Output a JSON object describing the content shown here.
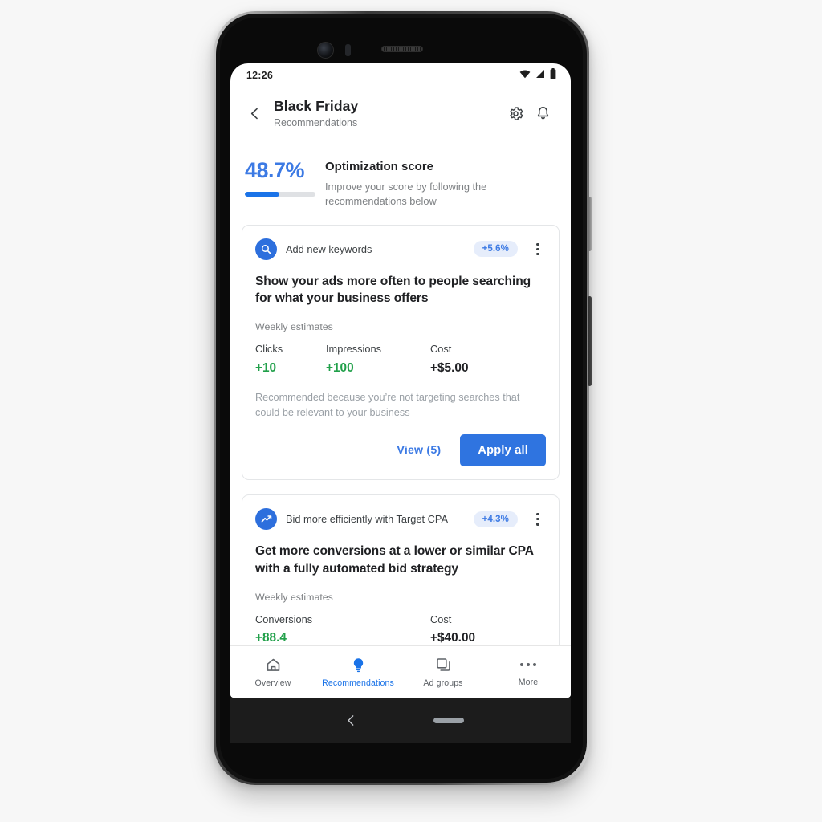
{
  "status_bar": {
    "time": "12:26",
    "icons": [
      "wifi-icon",
      "cellular-signal-icon",
      "battery-icon"
    ]
  },
  "app_bar": {
    "back_icon": "chevron-left-icon",
    "title": "Black Friday",
    "subtitle": "Recommendations",
    "actions": [
      {
        "icon": "gear-icon",
        "name": "settings"
      },
      {
        "icon": "bell-icon",
        "name": "notifications"
      }
    ]
  },
  "optimization_score": {
    "value": "48.7%",
    "progress_percent": 48.7,
    "heading": "Optimization score",
    "description": "Improve your score by following the recommendations below"
  },
  "cards": [
    {
      "icon": "search-icon",
      "type_label": "Add new keywords",
      "badge": "+5.6%",
      "menu_icon": "more-vertical-icon",
      "headline": "Show your ads more often to people searching for what your business offers",
      "estimates_label": "Weekly estimates",
      "stats": [
        {
          "label": "Clicks",
          "value": "+10",
          "tone": "positive"
        },
        {
          "label": "Impressions",
          "value": "+100",
          "tone": "positive"
        },
        {
          "label": "Cost",
          "value": "+$5.00",
          "tone": "neutral"
        }
      ],
      "reason": "Recommended because you’re not targeting searches that could be relevant to your business",
      "actions": {
        "secondary": "View (5)",
        "primary": "Apply all"
      }
    },
    {
      "icon": "trending-up-icon",
      "type_label": "Bid more efficiently with Target CPA",
      "badge": "+4.3%",
      "menu_icon": "more-vertical-icon",
      "headline": "Get more conversions at a lower or similar CPA with a fully automated bid strategy",
      "estimates_label": "Weekly estimates",
      "stats": [
        {
          "label": "Conversions",
          "value": "+88.4",
          "tone": "positive"
        },
        {
          "label": "Cost",
          "value": "+$40.00",
          "tone": "neutral"
        }
      ]
    }
  ],
  "bottom_nav": {
    "items": [
      {
        "label": "Overview",
        "icon": "home-icon",
        "active": false
      },
      {
        "label": "Recommendations",
        "icon": "lightbulb-icon",
        "active": true
      },
      {
        "label": "Ad groups",
        "icon": "layers-icon",
        "active": false
      },
      {
        "label": "More",
        "icon": "more-horizontal-icon",
        "active": false
      }
    ]
  },
  "system_nav": {
    "back_icon": "chevron-left-icon",
    "home_pill": "home-pill-indicator"
  },
  "colors": {
    "accent_blue": "#1a73e8",
    "score_blue": "#3c7ae4",
    "button_blue": "#2f74e0",
    "badge_bg": "#e6edfb",
    "positive_green": "#21a04a",
    "text_primary": "#202124",
    "text_secondary": "#7e8184"
  }
}
